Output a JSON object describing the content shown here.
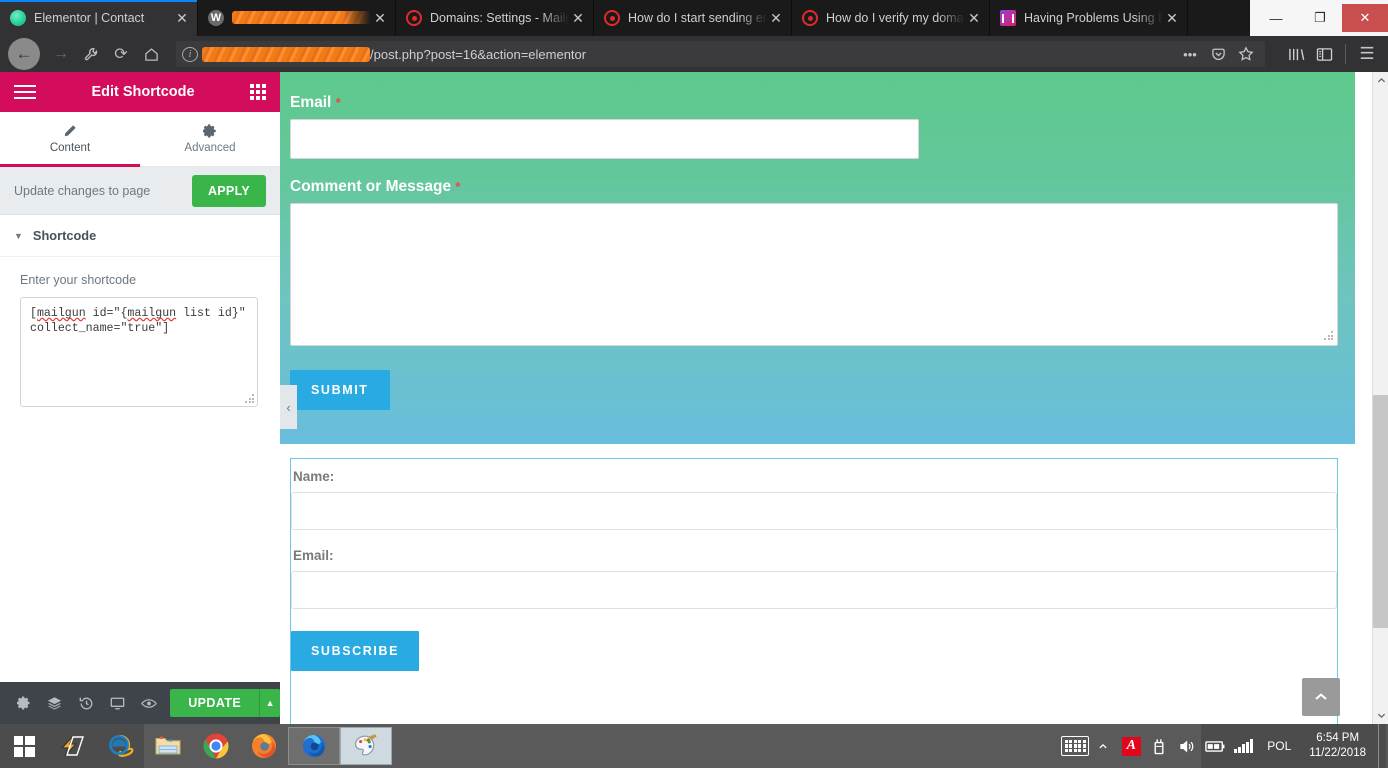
{
  "browser": {
    "tabs": [
      {
        "title": "Elementor | Contact",
        "favicon": "elementor-icon",
        "active": true,
        "redacted": false
      },
      {
        "title": "",
        "favicon": "wordpress-icon",
        "active": false,
        "redacted": true
      },
      {
        "title": "Domains: Settings - Mailgun",
        "favicon": "mailgun-icon",
        "active": false,
        "redacted": false
      },
      {
        "title": "How do I start sending email",
        "favicon": "mailgun-icon",
        "active": false,
        "redacted": false
      },
      {
        "title": "How do I verify my domain",
        "favicon": "mailgun-icon",
        "active": false,
        "redacted": false
      },
      {
        "title": "Having Problems Using Elementor",
        "favicon": "elementor-icon",
        "active": false,
        "redacted": false
      }
    ],
    "tab_close_glyph": "✕",
    "window_controls": {
      "minimize": "—",
      "maximize": "❐",
      "close": "✕"
    },
    "nav": {
      "back": "←",
      "forward": "→",
      "tools": "⚒",
      "reload": "⟳",
      "home": "⌂"
    },
    "url": {
      "info_glyph": "i",
      "redacted_prefix": true,
      "visible_text": "/post.php?post=16&action=elementor"
    },
    "url_actions": {
      "more": "•••",
      "pocket": "pocket-icon",
      "bookmark": "★"
    },
    "toolbar_right": {
      "library": "library-icon",
      "sidebar": "sidebar-icon",
      "menu": "☰"
    }
  },
  "panel": {
    "header": {
      "title": "Edit Shortcode",
      "menu_icon": "hamburger-icon",
      "grid_icon": "widgets-grid-icon",
      "color": "#d30c5c"
    },
    "tabs": [
      {
        "label": "Content",
        "icon": "pencil-icon",
        "active": true
      },
      {
        "label": "Advanced",
        "icon": "gear-icon",
        "active": false
      }
    ],
    "apply_row": {
      "text": "Update changes to page",
      "button": "APPLY",
      "button_color": "#39b54a"
    },
    "section": {
      "title": "Shortcode",
      "caret": "▼"
    },
    "field": {
      "label": "Enter your shortcode",
      "value_line1_a": "[",
      "value_line1_b": "mailgun",
      "value_line1_c": " id=\"{",
      "value_line1_d": "mailgun",
      "value_line1_e": " list id}\"",
      "value_line2": "collect_name=\"true\"]",
      "value_full": "[mailgun id=\"{mailgun list id}\" collect_name=\"true\"]"
    },
    "footer": {
      "icons": [
        {
          "name": "settings-gear-icon",
          "glyph": "⚙"
        },
        {
          "name": "navigator-layers-icon",
          "glyph": "layers"
        },
        {
          "name": "history-icon",
          "glyph": "history"
        },
        {
          "name": "responsive-mode-icon",
          "glyph": "monitor"
        },
        {
          "name": "preview-eye-icon",
          "glyph": "eye"
        }
      ],
      "update_label": "UPDATE",
      "update_caret": "▲",
      "update_color": "#39b54a"
    }
  },
  "preview": {
    "gradient_from": "#5ec98c",
    "gradient_to": "#68bedc",
    "contact_form": {
      "fields": [
        {
          "label": "Email",
          "required_mark": "*",
          "type": "input",
          "value": ""
        },
        {
          "label": "Comment or Message",
          "required_mark": "*",
          "type": "textarea",
          "value": ""
        }
      ],
      "submit_label": "SUBMIT",
      "submit_color": "#29aae3"
    },
    "collapse_handle": "‹",
    "subscribe_form": {
      "border_color": "#6ec6e8",
      "fields": [
        {
          "label": "Name:",
          "value": ""
        },
        {
          "label": "Email:",
          "value": ""
        }
      ],
      "subscribe_label": "SUBSCRIBE",
      "subscribe_color": "#29aae3"
    },
    "back_to_top": "︿"
  },
  "scrollbar": {
    "up_arrow": "▲",
    "down_arrow": "▼"
  },
  "taskbar": {
    "start": "windows-logo",
    "items": [
      {
        "name": "winamp-icon",
        "state": "pinned"
      },
      {
        "name": "internet-explorer-icon",
        "state": "pinned"
      },
      {
        "name": "file-explorer-icon",
        "state": "open"
      },
      {
        "name": "chrome-icon",
        "state": "open"
      },
      {
        "name": "firefox-icon",
        "state": "open"
      },
      {
        "name": "firefox-developer-icon",
        "state": "active"
      },
      {
        "name": "paint-icon",
        "state": "active"
      }
    ],
    "tray": {
      "keyboard": "keyboard-icon",
      "expand": "▲",
      "avira": "A",
      "usb": "usb-icon",
      "volume": "volume-icon",
      "battery": "battery-icon",
      "network": "signal-icon",
      "language": "POL",
      "time": "6:54 PM",
      "date": "11/22/2018"
    }
  }
}
